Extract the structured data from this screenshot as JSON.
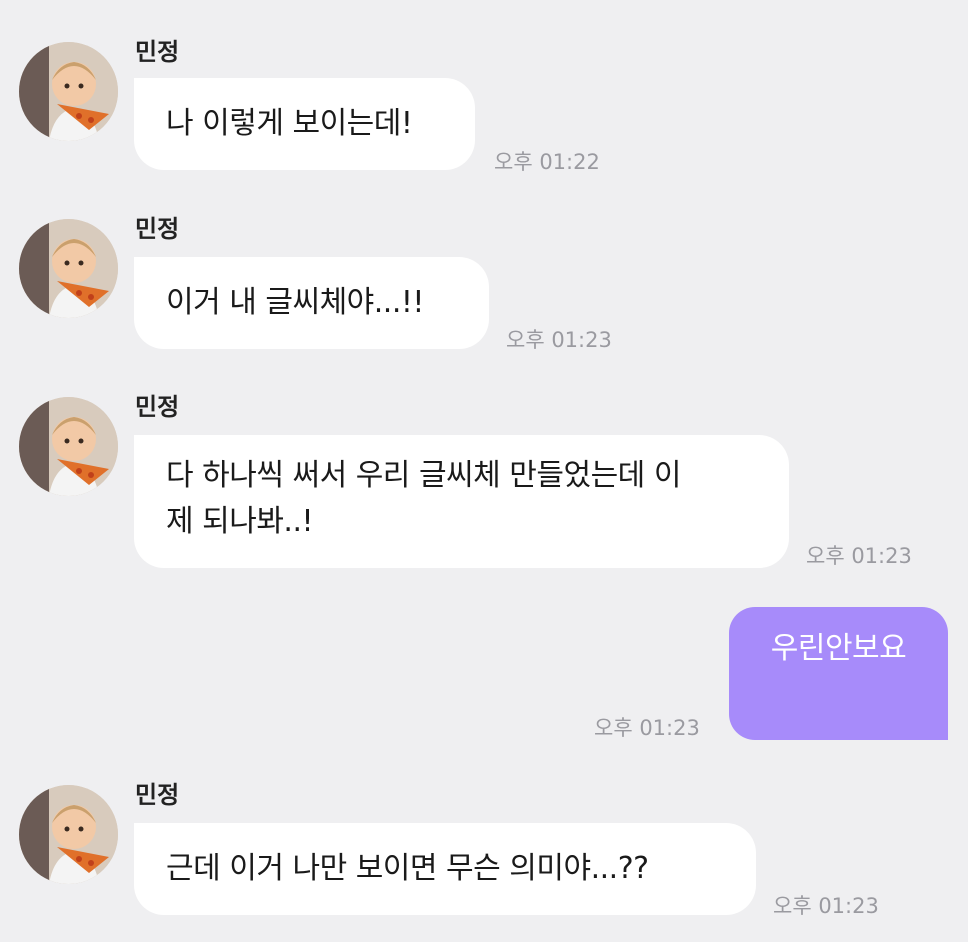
{
  "chat": {
    "messages": [
      {
        "sender": "민정",
        "text": "나 이렇게 보이는데!",
        "time": "오후 01:22"
      },
      {
        "sender": "민정",
        "text": "이거 내 글씨체야...!!",
        "time": "오후 01:23"
      },
      {
        "sender": "민정",
        "text_line1": "다 하나씩 써서 우리 글씨체 만들었는데 이",
        "text_line2": "제 되나봐..!",
        "time": "오후 01:23"
      },
      {
        "sender": "me",
        "text": "우린안보요",
        "time": "오후 01:23"
      },
      {
        "sender": "민정",
        "text": "근데 이거 나만 보이면 무슨 의미야...??",
        "time": "오후 01:23"
      }
    ]
  },
  "colors": {
    "background": "#efeff1",
    "incoming_bubble": "#ffffff",
    "outgoing_bubble": "#a78bfa",
    "timestamp": "#9a9aa0"
  },
  "icons": {
    "avatar": "child-eating-pizza-avatar-icon"
  }
}
